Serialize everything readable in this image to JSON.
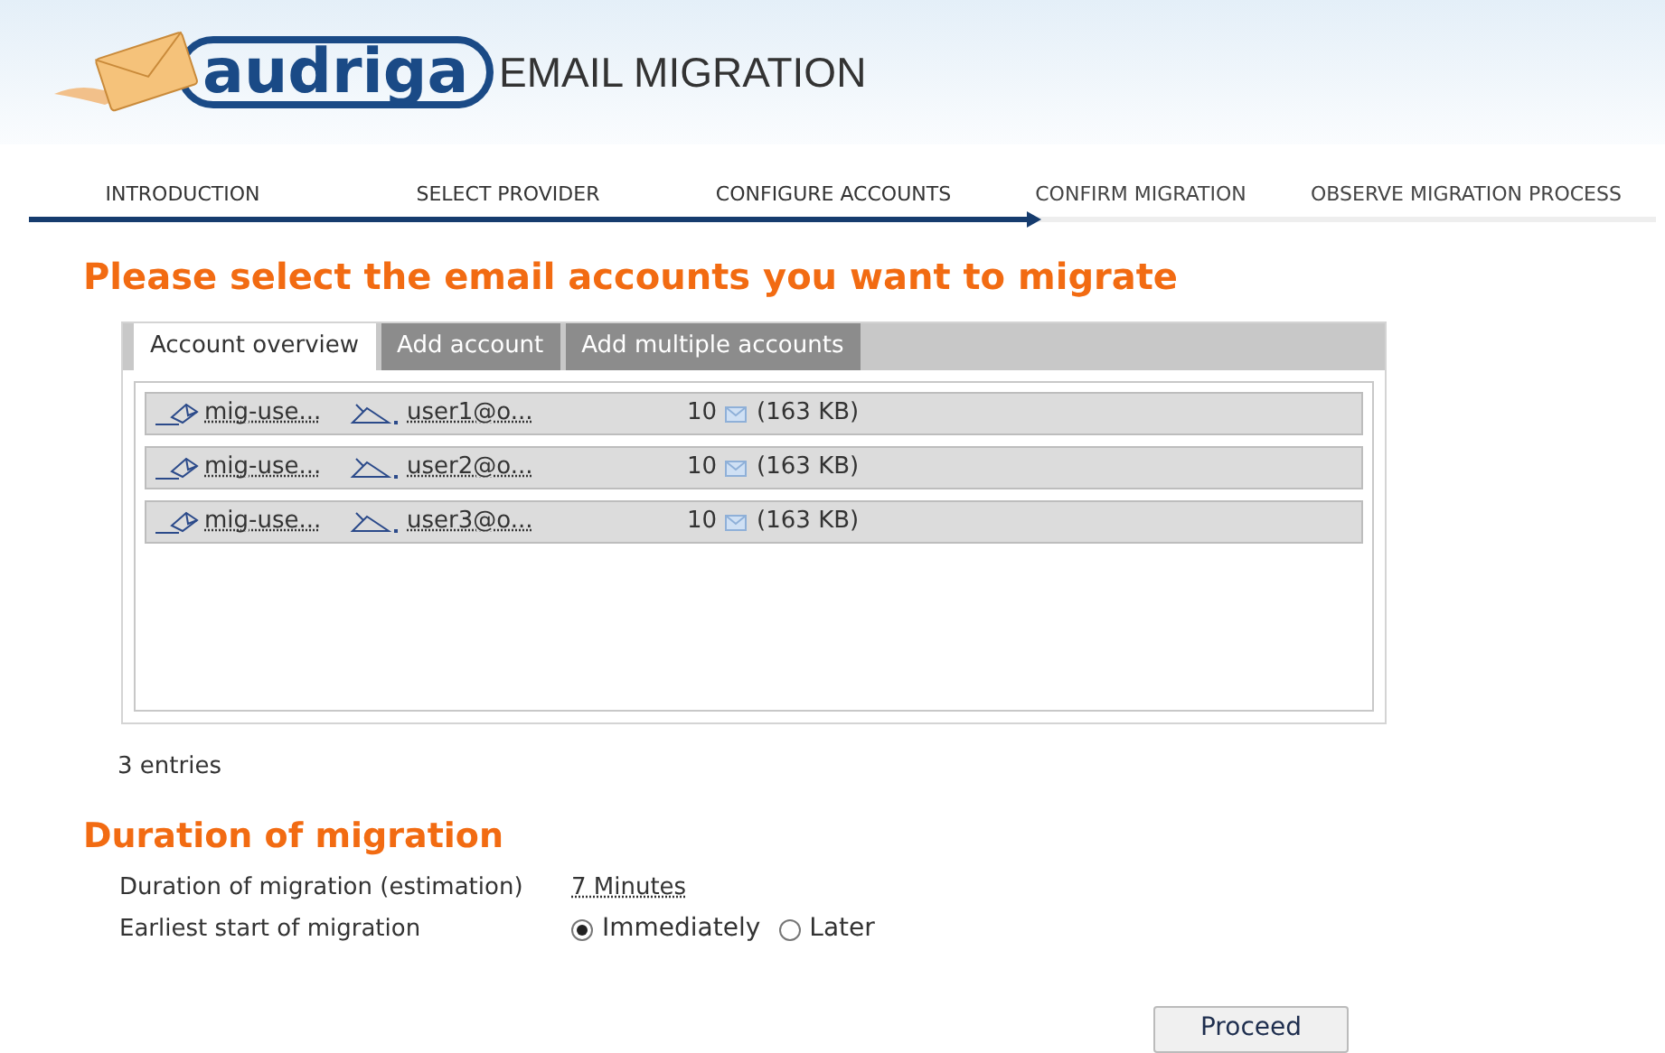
{
  "header": {
    "logo": "audriga",
    "title": "EMAIL MIGRATION"
  },
  "steps": [
    {
      "label": "INTRODUCTION",
      "completed": true
    },
    {
      "label": "SELECT PROVIDER",
      "completed": true
    },
    {
      "label": "CONFIGURE ACCOUNTS",
      "completed": true
    },
    {
      "label": "CONFIRM MIGRATION",
      "completed": false
    },
    {
      "label": "OBSERVE MIGRATION PROCESS",
      "completed": false
    }
  ],
  "heading": "Please select the email accounts you want to migrate",
  "tabs": [
    {
      "label": "Account overview",
      "selected": true
    },
    {
      "label": "Add account",
      "selected": false
    },
    {
      "label": "Add multiple accounts",
      "selected": false
    }
  ],
  "accounts": [
    {
      "source": "mig-use...",
      "target": "user1@o...",
      "count": "10",
      "size": "(163 KB)"
    },
    {
      "source": "mig-use...",
      "target": "user2@o...",
      "count": "10",
      "size": "(163 KB)"
    },
    {
      "source": "mig-use...",
      "target": "user3@o...",
      "count": "10",
      "size": "(163 KB)"
    }
  ],
  "entries": "3 entries",
  "duration": {
    "heading": "Duration of migration",
    "rows": [
      {
        "kind": "value",
        "label": "Duration of migration (estimation)",
        "value": "7 Minutes"
      },
      {
        "kind": "radio",
        "label": "Earliest start of migration",
        "options": [
          {
            "label": "Immediately",
            "selected": true
          },
          {
            "label": "Later",
            "selected": false
          }
        ]
      }
    ]
  },
  "proceed": "Proceed"
}
